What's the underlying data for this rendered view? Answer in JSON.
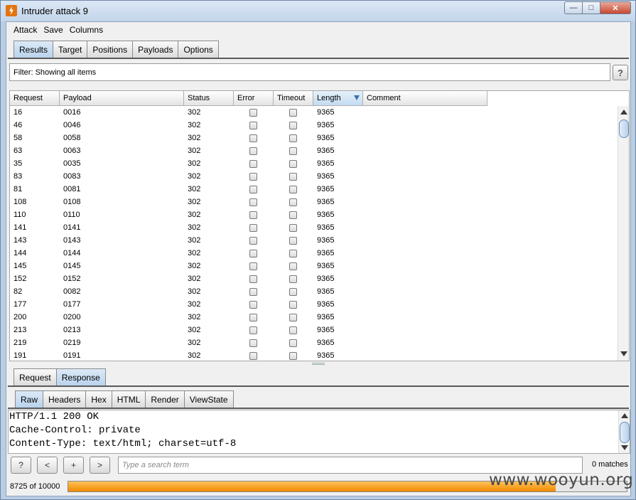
{
  "window": {
    "title": "Intruder attack 9",
    "minimize_icon": "minimize-icon",
    "maximize_icon": "maximize-icon",
    "close_icon": "close-icon"
  },
  "menu": {
    "items": [
      "Attack",
      "Save",
      "Columns"
    ]
  },
  "main_tabs": {
    "items": [
      "Results",
      "Target",
      "Positions",
      "Payloads",
      "Options"
    ],
    "active": "Results"
  },
  "filter": {
    "label": "Filter:",
    "text": "Showing all items",
    "help_label": "?"
  },
  "table": {
    "columns": [
      "Request",
      "Payload",
      "Status",
      "Error",
      "Timeout",
      "Length",
      "Comment"
    ],
    "sorted_column": "Length",
    "rows": [
      {
        "request": "16",
        "payload": "0016",
        "status": "302",
        "error": false,
        "timeout": false,
        "length": "9365",
        "comment": ""
      },
      {
        "request": "46",
        "payload": "0046",
        "status": "302",
        "error": false,
        "timeout": false,
        "length": "9365",
        "comment": ""
      },
      {
        "request": "58",
        "payload": "0058",
        "status": "302",
        "error": false,
        "timeout": false,
        "length": "9365",
        "comment": ""
      },
      {
        "request": "63",
        "payload": "0063",
        "status": "302",
        "error": false,
        "timeout": false,
        "length": "9365",
        "comment": ""
      },
      {
        "request": "35",
        "payload": "0035",
        "status": "302",
        "error": false,
        "timeout": false,
        "length": "9365",
        "comment": ""
      },
      {
        "request": "83",
        "payload": "0083",
        "status": "302",
        "error": false,
        "timeout": false,
        "length": "9365",
        "comment": ""
      },
      {
        "request": "81",
        "payload": "0081",
        "status": "302",
        "error": false,
        "timeout": false,
        "length": "9365",
        "comment": ""
      },
      {
        "request": "108",
        "payload": "0108",
        "status": "302",
        "error": false,
        "timeout": false,
        "length": "9365",
        "comment": ""
      },
      {
        "request": "110",
        "payload": "0110",
        "status": "302",
        "error": false,
        "timeout": false,
        "length": "9365",
        "comment": ""
      },
      {
        "request": "141",
        "payload": "0141",
        "status": "302",
        "error": false,
        "timeout": false,
        "length": "9365",
        "comment": ""
      },
      {
        "request": "143",
        "payload": "0143",
        "status": "302",
        "error": false,
        "timeout": false,
        "length": "9365",
        "comment": ""
      },
      {
        "request": "144",
        "payload": "0144",
        "status": "302",
        "error": false,
        "timeout": false,
        "length": "9365",
        "comment": ""
      },
      {
        "request": "145",
        "payload": "0145",
        "status": "302",
        "error": false,
        "timeout": false,
        "length": "9365",
        "comment": ""
      },
      {
        "request": "152",
        "payload": "0152",
        "status": "302",
        "error": false,
        "timeout": false,
        "length": "9365",
        "comment": ""
      },
      {
        "request": "82",
        "payload": "0082",
        "status": "302",
        "error": false,
        "timeout": false,
        "length": "9365",
        "comment": ""
      },
      {
        "request": "177",
        "payload": "0177",
        "status": "302",
        "error": false,
        "timeout": false,
        "length": "9365",
        "comment": ""
      },
      {
        "request": "200",
        "payload": "0200",
        "status": "302",
        "error": false,
        "timeout": false,
        "length": "9365",
        "comment": ""
      },
      {
        "request": "213",
        "payload": "0213",
        "status": "302",
        "error": false,
        "timeout": false,
        "length": "9365",
        "comment": ""
      },
      {
        "request": "219",
        "payload": "0219",
        "status": "302",
        "error": false,
        "timeout": false,
        "length": "9365",
        "comment": ""
      },
      {
        "request": "191",
        "payload": "0191",
        "status": "302",
        "error": false,
        "timeout": false,
        "length": "9365",
        "comment": ""
      }
    ]
  },
  "message_tabs": {
    "items": [
      "Request",
      "Response"
    ],
    "active": "Response"
  },
  "view_tabs": {
    "items": [
      "Raw",
      "Headers",
      "Hex",
      "HTML",
      "Render",
      "ViewState"
    ],
    "active": "Raw"
  },
  "response": {
    "lines": [
      "HTTP/1.1 200 OK",
      "Cache-Control: private",
      "Content-Type: text/html; charset=utf-8"
    ]
  },
  "search": {
    "help_label": "?",
    "prev_label": "<",
    "add_label": "+",
    "next_label": ">",
    "placeholder": "Type a search term",
    "matches": "0 matches"
  },
  "progress": {
    "label": "8725 of 10000",
    "done": 8725,
    "total": 10000
  },
  "watermark": "www.wooyun.org",
  "colors": {
    "progress": "#f08a00",
    "active_tab": "#b9d2ec",
    "sorted_header": "#c4dbf1"
  }
}
